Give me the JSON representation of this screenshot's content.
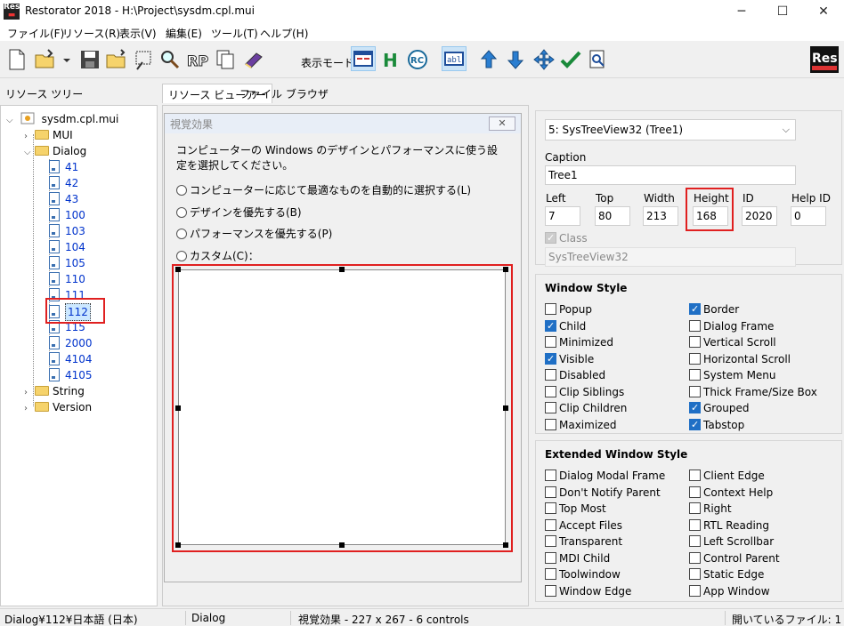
{
  "window": {
    "app_icon": "Res",
    "title": "Restorator 2018 - H:\\Project\\sysdm.cpl.mui",
    "minimize": "─",
    "maximize": "☐",
    "close": "✕"
  },
  "menu": [
    "ファイル(F)",
    "リソース(R)",
    "表示(V)",
    "編集(E)",
    "ツール(T)",
    "ヘルプ(H)"
  ],
  "toolbar": {
    "view_mode_label": "表示モード:",
    "icons": [
      "new-file-icon",
      "open-folder-icon",
      "dropdown-arrow-icon",
      "save-icon",
      "open-folder2-icon",
      "lasso-icon",
      "find-icon",
      "rp-icon",
      "copy-icon",
      "book-icon",
      "dialog-view-icon",
      "h-view-icon",
      "rc-view-icon",
      "text-view-icon",
      "arrow-up-icon",
      "arrow-down-icon",
      "move-icon",
      "checkmark-icon",
      "inspect-icon",
      "res-logo-icon"
    ]
  },
  "tree_panel": {
    "header": "リソース ツリー",
    "root": "sysdm.cpl.mui",
    "folders": [
      "MUI",
      "Dialog",
      "String",
      "Version"
    ],
    "dialog_items": [
      "41",
      "42",
      "43",
      "100",
      "103",
      "104",
      "105",
      "110",
      "111",
      "112",
      "115",
      "2000",
      "4104",
      "4105"
    ],
    "selected": "112"
  },
  "tabs": [
    "リソース ビューアー",
    "ファイル ブラウザ"
  ],
  "dialog": {
    "title": "視覚効果",
    "close_label": "✕",
    "description": "コンピューターの Windows のデザインとパフォーマンスに使う設定を選択してください。",
    "options": [
      "コンピューターに応じて最適なものを自動的に選択する(L)",
      "デザインを優先する(B)",
      "パフォーマンスを優先する(P)",
      "カスタム(C)："
    ]
  },
  "properties": {
    "control_select": "5: SysTreeView32 (Tree1)",
    "caption_label": "Caption",
    "caption_value": "Tree1",
    "fields": [
      {
        "label": "Left",
        "value": "7"
      },
      {
        "label": "Top",
        "value": "80"
      },
      {
        "label": "Width",
        "value": "213"
      },
      {
        "label": "Height",
        "value": "168"
      },
      {
        "label": "ID",
        "value": "2020"
      },
      {
        "label": "Help ID",
        "value": "0"
      }
    ],
    "class_label": "Class",
    "class_value": "SysTreeView32"
  },
  "window_style": {
    "title": "Window Style",
    "left": [
      {
        "label": "Popup",
        "checked": false
      },
      {
        "label": "Child",
        "checked": true
      },
      {
        "label": "Minimized",
        "checked": false
      },
      {
        "label": "Visible",
        "checked": true
      },
      {
        "label": "Disabled",
        "checked": false
      },
      {
        "label": "Clip Siblings",
        "checked": false
      },
      {
        "label": "Clip Children",
        "checked": false
      },
      {
        "label": "Maximized",
        "checked": false
      }
    ],
    "right": [
      {
        "label": "Border",
        "checked": true
      },
      {
        "label": "Dialog Frame",
        "checked": false
      },
      {
        "label": "Vertical Scroll",
        "checked": false
      },
      {
        "label": "Horizontal Scroll",
        "checked": false
      },
      {
        "label": "System Menu",
        "checked": false
      },
      {
        "label": "Thick Frame/Size Box",
        "checked": false
      },
      {
        "label": "Grouped",
        "checked": true
      },
      {
        "label": "Tabstop",
        "checked": true
      }
    ]
  },
  "ext_style": {
    "title": "Extended Window Style",
    "left": [
      {
        "label": "Dialog Modal Frame",
        "checked": false
      },
      {
        "label": "Don't Notify Parent",
        "checked": false
      },
      {
        "label": "Top Most",
        "checked": false
      },
      {
        "label": "Accept Files",
        "checked": false
      },
      {
        "label": "Transparent",
        "checked": false
      },
      {
        "label": "MDI Child",
        "checked": false
      },
      {
        "label": "Toolwindow",
        "checked": false
      },
      {
        "label": "Window Edge",
        "checked": false
      }
    ],
    "right": [
      {
        "label": "Client Edge",
        "checked": false
      },
      {
        "label": "Context Help",
        "checked": false
      },
      {
        "label": "Right",
        "checked": false
      },
      {
        "label": "RTL Reading",
        "checked": false
      },
      {
        "label": "Left Scrollbar",
        "checked": false
      },
      {
        "label": "Control Parent",
        "checked": false
      },
      {
        "label": "Static Edge",
        "checked": false
      },
      {
        "label": "App Window",
        "checked": false
      }
    ]
  },
  "status": {
    "path": "Dialog¥112¥日本語 (日本)",
    "type": "Dialog",
    "info": "視覚効果 - 227 x 267 - 6 controls",
    "open_files": "開いているファイル: 1"
  }
}
